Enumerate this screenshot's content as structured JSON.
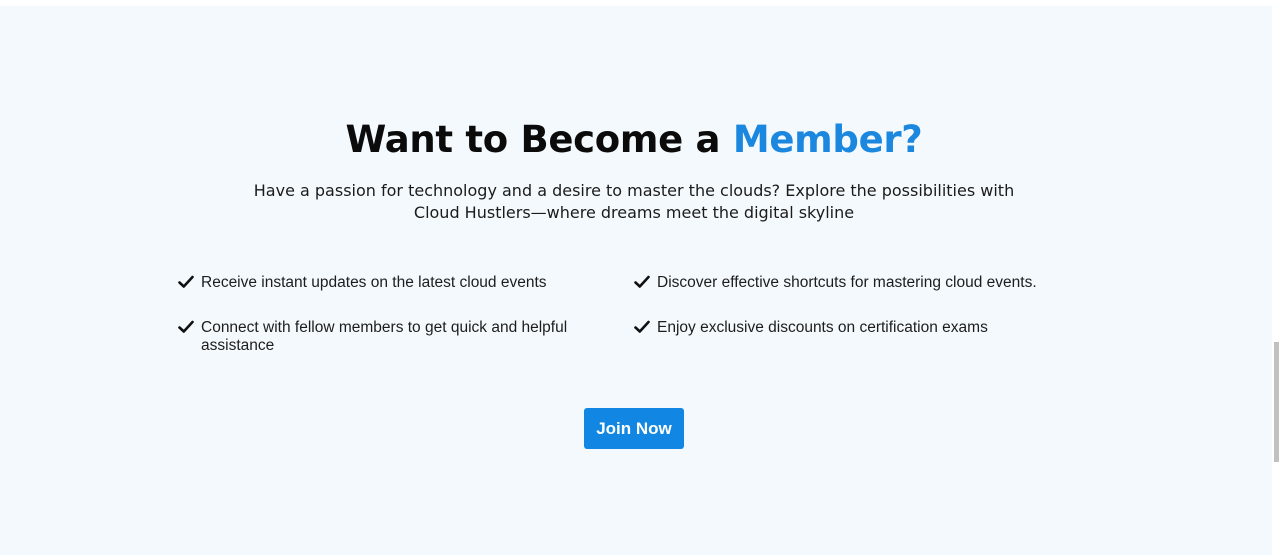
{
  "section": {
    "title_main": "Want to Become a ",
    "title_accent": "Member?",
    "subtitle": "Have a passion for technology and a desire to master the clouds? Explore the possibilities with Cloud Hustlers—where dreams meet the digital skyline",
    "features": [
      {
        "icon": "checkmark-icon",
        "text": "Receive instant updates on the latest cloud events"
      },
      {
        "icon": "checkmark-icon",
        "text": "Connect with fellow members to get quick and helpful assistance"
      },
      {
        "icon": "checkmark-icon",
        "text": "Discover effective shortcuts for mastering cloud events."
      },
      {
        "icon": "checkmark-icon",
        "text": "Enjoy exclusive discounts on certification exams"
      }
    ],
    "join_button_label": "Join Now"
  },
  "colors": {
    "accent": "#1b87de",
    "button_bg": "#1187e3",
    "section_bg": "#f3f9fd",
    "text": "#0b0b0b"
  }
}
